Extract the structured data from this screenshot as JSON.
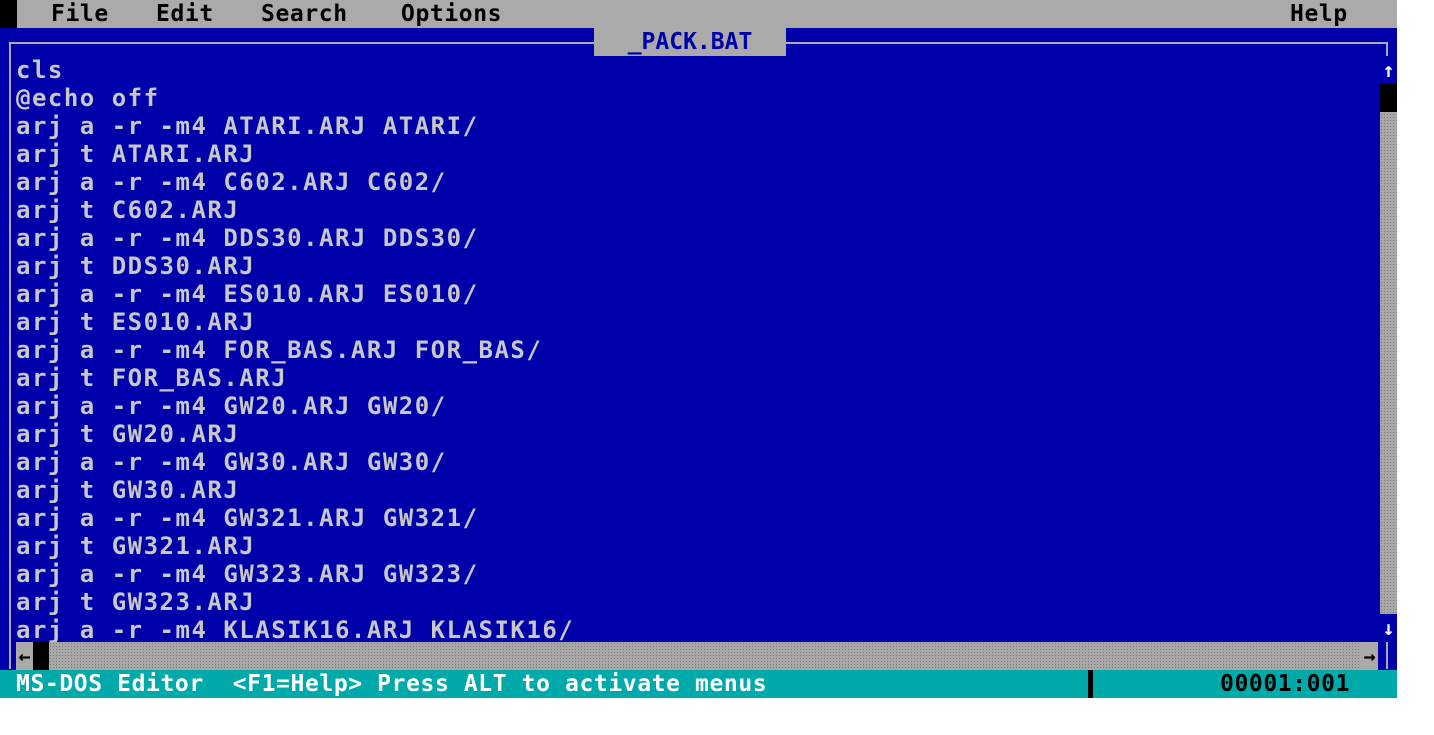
{
  "menubar": {
    "items": [
      "File",
      "Edit",
      "Search",
      "Options"
    ],
    "help": "Help"
  },
  "window": {
    "title": "_PACK.BAT"
  },
  "editor": {
    "lines": [
      "cls",
      "@echo off",
      "arj a -r -m4 ATARI.ARJ ATARI/",
      "arj t ATARI.ARJ",
      "arj a -r -m4 C602.ARJ C602/",
      "arj t C602.ARJ",
      "arj a -r -m4 DDS30.ARJ DDS30/",
      "arj t DDS30.ARJ",
      "arj a -r -m4 ES010.ARJ ES010/",
      "arj t ES010.ARJ",
      "arj a -r -m4 FOR_BAS.ARJ FOR_BAS/",
      "arj t FOR_BAS.ARJ",
      "arj a -r -m4 GW20.ARJ GW20/",
      "arj t GW20.ARJ",
      "arj a -r -m4 GW30.ARJ GW30/",
      "arj t GW30.ARJ",
      "arj a -r -m4 GW321.ARJ GW321/",
      "arj t GW321.ARJ",
      "arj a -r -m4 GW323.ARJ GW323/",
      "arj t GW323.ARJ",
      "arj a -r -m4 KLASIK16.ARJ KLASIK16/"
    ]
  },
  "scrollbars": {
    "up": "↑",
    "down": "↓",
    "left": "←",
    "right": "→"
  },
  "statusbar": {
    "text": "MS-DOS Editor  <F1=Help> Press ALT to activate menus",
    "position": "00001:001"
  },
  "colors": {
    "editor_bg": "#0000aa",
    "menu_bg": "#aaaaaa",
    "status_bg": "#00aaaa",
    "text": "#c8c8c8"
  }
}
